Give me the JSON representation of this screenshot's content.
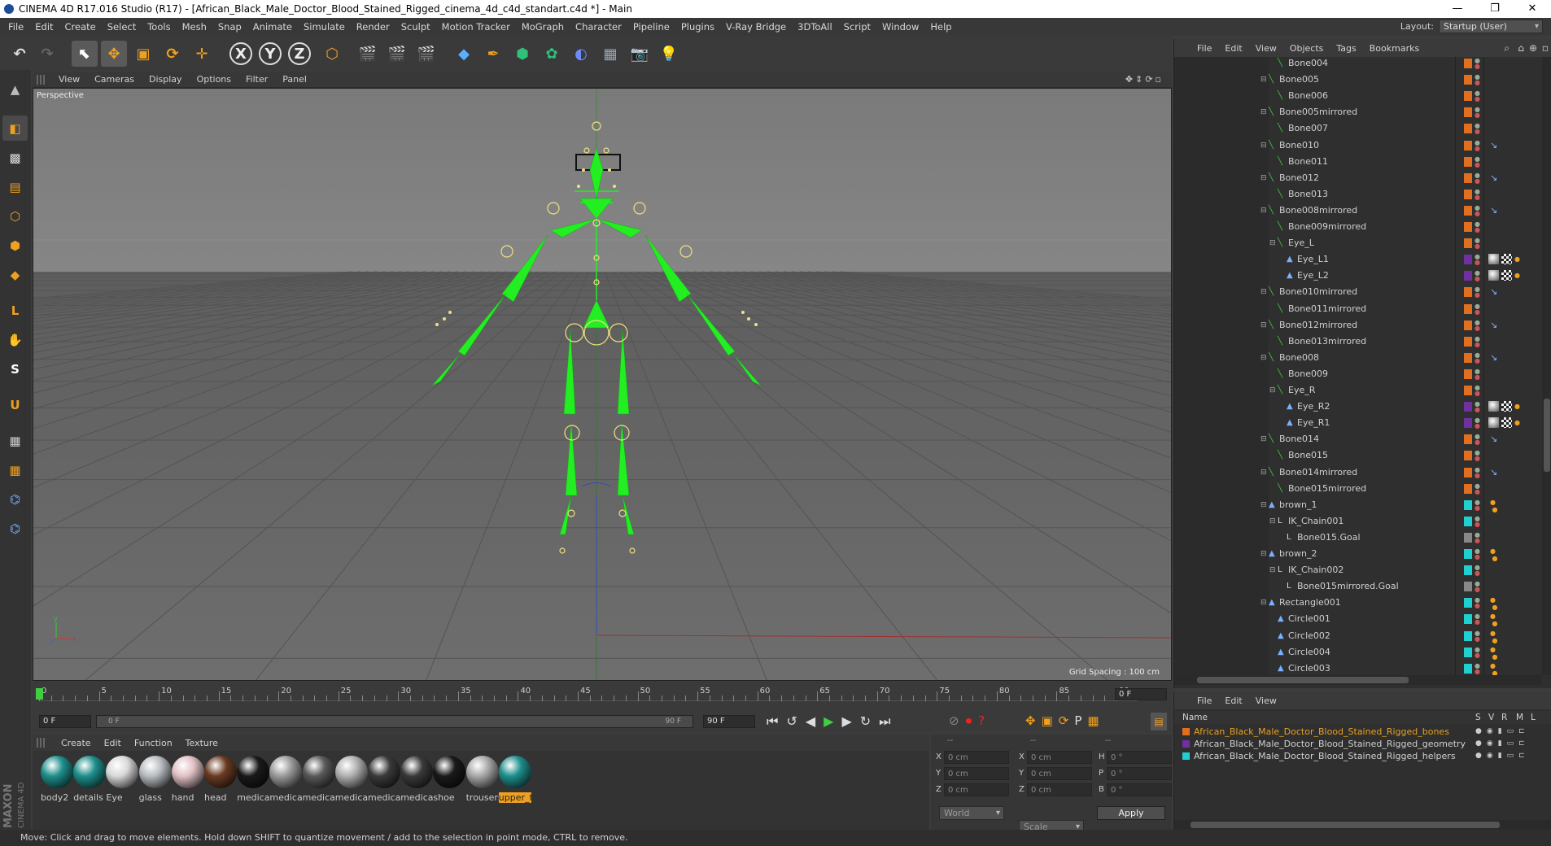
{
  "window": {
    "title": "CINEMA 4D R17.016 Studio (R17) - [African_Black_Male_Doctor_Blood_Stained_Rigged_cinema_4d_c4d_standart.c4d *] - Main",
    "minimize": "—",
    "maximize": "❐",
    "close": "✕"
  },
  "menu": [
    "File",
    "Edit",
    "Create",
    "Select",
    "Tools",
    "Mesh",
    "Snap",
    "Animate",
    "Simulate",
    "Render",
    "Sculpt",
    "Motion Tracker",
    "MoGraph",
    "Character",
    "Pipeline",
    "Plugins",
    "V-Ray Bridge",
    "3DToAll",
    "Script",
    "Window",
    "Help"
  ],
  "layout": {
    "label": "Layout:",
    "value": "Startup (User)"
  },
  "toolbar_axes": [
    "X",
    "Y",
    "Z"
  ],
  "viewport": {
    "menu": [
      "View",
      "Cameras",
      "Display",
      "Options",
      "Filter",
      "Panel"
    ],
    "camera_label": "Perspective",
    "grid_spacing": "Grid Spacing : 100 cm"
  },
  "timeline": {
    "ticks": [
      "0",
      "5",
      "10",
      "15",
      "20",
      "25",
      "30",
      "35",
      "40",
      "45",
      "50",
      "55",
      "60",
      "65",
      "70",
      "75",
      "80",
      "85",
      "90"
    ],
    "current_frame": "0 F"
  },
  "transport": {
    "start_field": "0 F",
    "slider_start": "0 F",
    "slider_end": "90 F",
    "end_field": "90 F"
  },
  "materials": {
    "menu": [
      "Create",
      "Edit",
      "Function",
      "Texture"
    ],
    "items": [
      {
        "label": "body2",
        "color": "#1e8f8c"
      },
      {
        "label": "details",
        "color": "#1e8f8c"
      },
      {
        "label": "Eye",
        "color": "#d8d8d8"
      },
      {
        "label": "glass",
        "color": "#b8bcc0"
      },
      {
        "label": "hand",
        "color": "#e0c0c4"
      },
      {
        "label": "head",
        "color": "#6a3a22"
      },
      {
        "label": "medical",
        "color": "#1a1a1a"
      },
      {
        "label": "medical",
        "color": "#9a9a9a"
      },
      {
        "label": "medical",
        "color": "#5a5a5a"
      },
      {
        "label": "medical",
        "color": "#b0b0b0"
      },
      {
        "label": "medical",
        "color": "#3a3a3a"
      },
      {
        "label": "medical",
        "color": "#3a3a3a"
      },
      {
        "label": "shoe",
        "color": "#1a1a1a"
      },
      {
        "label": "trousers",
        "color": "#a8a8a8"
      },
      {
        "label": "upper_t",
        "color": "#1e8f8c"
      }
    ]
  },
  "coords": {
    "headers": [
      "--",
      "--",
      "--"
    ],
    "rows": [
      {
        "a": "X",
        "av": "0 cm",
        "b": "X",
        "bv": "0 cm",
        "c": "H",
        "cv": "0 °"
      },
      {
        "a": "Y",
        "av": "0 cm",
        "b": "Y",
        "bv": "0 cm",
        "c": "P",
        "cv": "0 °"
      },
      {
        "a": "Z",
        "av": "0 cm",
        "b": "Z",
        "bv": "0 cm",
        "c": "B",
        "cv": "0 °"
      }
    ],
    "world": "World",
    "scale": "Scale",
    "apply": "Apply"
  },
  "objects": {
    "menu": [
      "File",
      "Edit",
      "View",
      "Objects",
      "Tags",
      "Bookmarks"
    ],
    "rows": [
      {
        "name": "Bone004",
        "indent": 4,
        "type": "bone",
        "color": "#e07020",
        "tag": ""
      },
      {
        "name": "Bone005",
        "indent": 3,
        "type": "bone",
        "color": "#e07020",
        "tag": ""
      },
      {
        "name": "Bone006",
        "indent": 4,
        "type": "bone",
        "color": "#e07020",
        "tag": ""
      },
      {
        "name": "Bone005mirrored",
        "indent": 3,
        "type": "bone",
        "color": "#e07020",
        "tag": ""
      },
      {
        "name": "Bone007",
        "indent": 4,
        "type": "bone",
        "color": "#e07020",
        "tag": ""
      },
      {
        "name": "Bone010",
        "indent": 3,
        "type": "bone",
        "color": "#e07020",
        "tag": "ik"
      },
      {
        "name": "Bone011",
        "indent": 4,
        "type": "bone",
        "color": "#e07020",
        "tag": ""
      },
      {
        "name": "Bone012",
        "indent": 3,
        "type": "bone",
        "color": "#e07020",
        "tag": "ik"
      },
      {
        "name": "Bone013",
        "indent": 4,
        "type": "bone",
        "color": "#e07020",
        "tag": ""
      },
      {
        "name": "Bone008mirrored",
        "indent": 3,
        "type": "bone",
        "color": "#e07020",
        "tag": "ik"
      },
      {
        "name": "Bone009mirrored",
        "indent": 4,
        "type": "bone",
        "color": "#e07020",
        "tag": ""
      },
      {
        "name": "Eye_L",
        "indent": 4,
        "type": "bone",
        "color": "#e07020",
        "tag": ""
      },
      {
        "name": "Eye_L1",
        "indent": 5,
        "type": "mesh",
        "color": "#7030a0",
        "tag": "mat"
      },
      {
        "name": "Eye_L2",
        "indent": 5,
        "type": "mesh",
        "color": "#7030a0",
        "tag": "mat"
      },
      {
        "name": "Bone010mirrored",
        "indent": 3,
        "type": "bone",
        "color": "#e07020",
        "tag": "ik"
      },
      {
        "name": "Bone011mirrored",
        "indent": 4,
        "type": "bone",
        "color": "#e07020",
        "tag": ""
      },
      {
        "name": "Bone012mirrored",
        "indent": 3,
        "type": "bone",
        "color": "#e07020",
        "tag": "ik"
      },
      {
        "name": "Bone013mirrored",
        "indent": 4,
        "type": "bone",
        "color": "#e07020",
        "tag": ""
      },
      {
        "name": "Bone008",
        "indent": 3,
        "type": "bone",
        "color": "#e07020",
        "tag": "ik"
      },
      {
        "name": "Bone009",
        "indent": 4,
        "type": "bone",
        "color": "#e07020",
        "tag": ""
      },
      {
        "name": "Eye_R",
        "indent": 4,
        "type": "bone",
        "color": "#e07020",
        "tag": ""
      },
      {
        "name": "Eye_R2",
        "indent": 5,
        "type": "mesh",
        "color": "#7030a0",
        "tag": "mat"
      },
      {
        "name": "Eye_R1",
        "indent": 5,
        "type": "mesh",
        "color": "#7030a0",
        "tag": "mat"
      },
      {
        "name": "Bone014",
        "indent": 3,
        "type": "bone",
        "color": "#e07020",
        "tag": "ik"
      },
      {
        "name": "Bone015",
        "indent": 4,
        "type": "bone",
        "color": "#e07020",
        "tag": ""
      },
      {
        "name": "Bone014mirrored",
        "indent": 3,
        "type": "bone",
        "color": "#e07020",
        "tag": "ik"
      },
      {
        "name": "Bone015mirrored",
        "indent": 4,
        "type": "bone",
        "color": "#e07020",
        "tag": ""
      },
      {
        "name": "brown_1",
        "indent": 3,
        "type": "spline",
        "color": "#20d0d0",
        "tag": "dots"
      },
      {
        "name": "IK_Chain001",
        "indent": 4,
        "type": "ik",
        "color": "#20d0d0",
        "tag": ""
      },
      {
        "name": "Bone015.Goal",
        "indent": 5,
        "type": "ik",
        "color": "#888888",
        "tag": ""
      },
      {
        "name": "brown_2",
        "indent": 3,
        "type": "spline",
        "color": "#20d0d0",
        "tag": "dots"
      },
      {
        "name": "IK_Chain002",
        "indent": 4,
        "type": "ik",
        "color": "#20d0d0",
        "tag": ""
      },
      {
        "name": "Bone015mirrored.Goal",
        "indent": 5,
        "type": "ik",
        "color": "#888888",
        "tag": ""
      },
      {
        "name": "Rectangle001",
        "indent": 3,
        "type": "spline",
        "color": "#20d0d0",
        "tag": "dots"
      },
      {
        "name": "Circle001",
        "indent": 4,
        "type": "spline",
        "color": "#20d0d0",
        "tag": "dots"
      },
      {
        "name": "Circle002",
        "indent": 4,
        "type": "spline",
        "color": "#20d0d0",
        "tag": "dots"
      },
      {
        "name": "Circle004",
        "indent": 4,
        "type": "spline",
        "color": "#20d0d0",
        "tag": "dots"
      },
      {
        "name": "Circle003",
        "indent": 4,
        "type": "spline",
        "color": "#20d0d0",
        "tag": "dots"
      }
    ]
  },
  "layers": {
    "menu": [
      "File",
      "Edit",
      "View"
    ],
    "headers": [
      "Name",
      "S",
      "V",
      "R",
      "M",
      "L"
    ],
    "rows": [
      {
        "name": "African_Black_Male_Doctor_Blood_Stained_Rigged_bones",
        "color": "#e07020",
        "text": "#e8a020"
      },
      {
        "name": "African_Black_Male_Doctor_Blood_Stained_Rigged_geometry",
        "color": "#7030a0",
        "text": "#d0d0d0"
      },
      {
        "name": "African_Black_Male_Doctor_Blood_Stained_Rigged_helpers",
        "color": "#20d0d0",
        "text": "#d0d0d0"
      }
    ]
  },
  "status": "Move: Click and drag to move elements. Hold down SHIFT to quantize movement / add to the selection in point mode, CTRL to remove.",
  "brand": {
    "maxon": "MAXON",
    "cinema": "CINEMA 4D"
  },
  "accent": "#f0a020",
  "bone_color": "#22ee22"
}
